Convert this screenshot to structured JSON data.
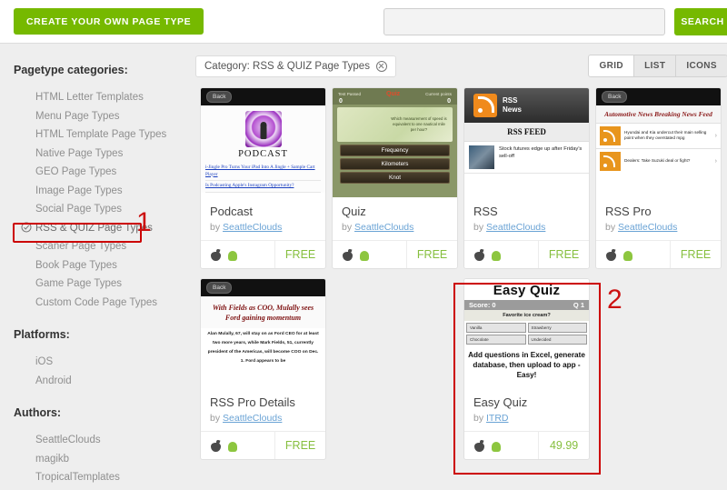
{
  "topbar": {
    "create_button": "CREATE YOUR OWN PAGE TYPE",
    "search_value": "",
    "search_placeholder": "",
    "search_button": "SEARCH"
  },
  "sidebar": {
    "categories_heading": "Pagetype categories:",
    "categories": [
      "HTML Letter Templates",
      "Menu Page Types",
      "HTML Template Page Types",
      "Native Page Types",
      "GEO Page Types",
      "Image Page Types",
      "Social Page Types",
      "RSS & QUIZ Page Types",
      "Scaner Page Types",
      "Book Page Types",
      "Game Page Types",
      "Custom Code Page Types"
    ],
    "selected_category": "RSS & QUIZ Page Types",
    "platforms_heading": "Platforms:",
    "platforms": [
      "iOS",
      "Android"
    ],
    "authors_heading": "Authors:",
    "authors": [
      "SeattleClouds",
      "magikb",
      "TropicalTemplates"
    ]
  },
  "main": {
    "filter_chip": "Category: RSS & QUIZ Page Types",
    "view_modes": [
      "GRID",
      "LIST",
      "ICONS"
    ],
    "active_view": "GRID"
  },
  "annotations": [
    {
      "label": "1",
      "target": "RSS & QUIZ Page Types sidebar item"
    },
    {
      "label": "2",
      "target": "Easy Quiz card"
    }
  ],
  "accent_colors": {
    "green": "#76b900",
    "price_green": "#86bf3e",
    "annotation_red": "#cc0000",
    "link_blue": "#6aa3d5"
  },
  "cards": [
    {
      "title": "Podcast",
      "by_label": "by",
      "author": "SeattleClouds",
      "price": "FREE",
      "platforms": [
        "apple-icon",
        "android-icon"
      ],
      "preview": {
        "back_button": "Back",
        "word": "PODCAST",
        "links": [
          "i-Jingle Pro Turns Your iPad Into A Jingle + Sample Cart Player",
          "Is Podcasting Apple's Instagram Opportunity?"
        ]
      }
    },
    {
      "title": "Quiz",
      "by_label": "by",
      "author": "SeattleClouds",
      "price": "FREE",
      "platforms": [
        "apple-icon",
        "android-icon"
      ],
      "preview": {
        "left_label": "Test Passed",
        "center_label": "Quiz",
        "right_label": "Current points",
        "left_value": "0",
        "right_value": "0",
        "question": "Which measurement of speed is equivalent to one nautical mile per hour?",
        "answers": [
          "Frequency",
          "Kilometers",
          "Knot"
        ]
      }
    },
    {
      "title": "RSS",
      "by_label": "by",
      "author": "SeattleClouds",
      "price": "FREE",
      "platforms": [
        "apple-icon",
        "android-icon"
      ],
      "preview": {
        "brand_line1": "RSS",
        "brand_line2": "News",
        "feed_heading": "RSS FEED",
        "items": [
          "Stock futures edge up after Friday's sell-off"
        ]
      }
    },
    {
      "title": "RSS Pro",
      "by_label": "by",
      "author": "SeattleClouds",
      "price": "FREE",
      "platforms": [
        "apple-icon",
        "android-icon"
      ],
      "preview": {
        "back_button": "Back",
        "heading": "Automotive News Breaking News Feed",
        "items": [
          "Hyundai and Kia undercut their main selling point when they overstated mpg",
          "Dealers: Take Suzuki deal or fight?"
        ]
      }
    },
    {
      "title": "RSS Pro Details",
      "by_label": "by",
      "author": "SeattleClouds",
      "price": "FREE",
      "platforms": [
        "apple-icon",
        "android-icon"
      ],
      "preview": {
        "back_button": "Back",
        "heading": "With Fields as COO, Mulally sees Ford gaining momentum",
        "body": "Alan Mulally, 67, will stay on as Ford CEO for at least two more years, while Mark Fields, 51, currently president of the Americas, will become COO on Dec. 1. Ford appears to be"
      }
    },
    {
      "title": "Easy Quiz",
      "by_label": "by",
      "author": "ITRD",
      "price": "49.99",
      "platforms": [
        "apple-icon",
        "android-icon"
      ],
      "highlighted": true,
      "preview": {
        "app_title": "Easy Quiz",
        "score_label": "Score: 0",
        "question_counter": "Q 1",
        "question": "Favorite ice cream?",
        "answers": [
          "Vanilla",
          "Strawberry",
          "Chocolate",
          "Undecided"
        ],
        "description": "Add questions in Excel, generate database, then upload to app - Easy!"
      }
    }
  ]
}
